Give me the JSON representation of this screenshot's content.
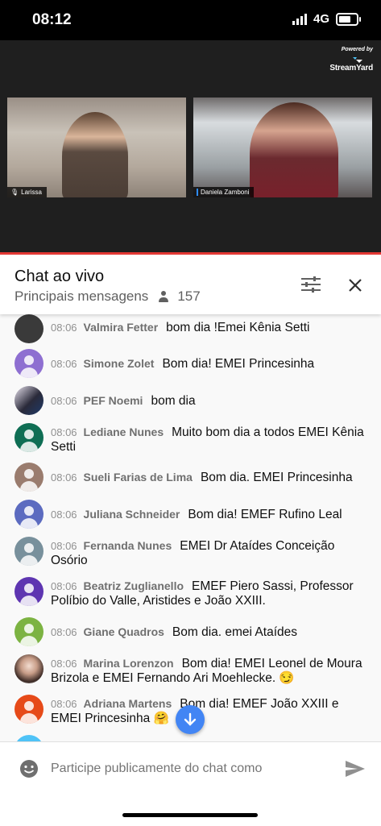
{
  "status_bar": {
    "time": "08:12",
    "network": "4G"
  },
  "stream": {
    "powered_by": "Powered by",
    "brand": "StreamYard",
    "participants": [
      {
        "name": "Larissa"
      },
      {
        "name": "Daniela Zamboni"
      }
    ]
  },
  "chat": {
    "title": "Chat ao vivo",
    "mode": "Principais mensagens",
    "viewer_count": "157",
    "messages": [
      {
        "time": "08:06",
        "author": "Valmira Fetter",
        "text": "bom dia !Emei Kênia Setti",
        "avatar_color": "#3a3a3a"
      },
      {
        "time": "08:06",
        "author": "Simone Zolet",
        "text": "Bom dia! EMEI Princesinha",
        "avatar_color": "#8e6fd1"
      },
      {
        "time": "08:06",
        "author": "PEF Noemi",
        "text": "bom dia",
        "avatar_color": "#d9d2e6"
      },
      {
        "time": "08:06",
        "author": "Lediane Nunes",
        "text": "Muito bom dia a todos EMEI Kênia Setti",
        "avatar_color": "#0f6e54"
      },
      {
        "time": "08:06",
        "author": "Sueli Farias de Lima",
        "text": "Bom dia. EMEI Princesinha",
        "avatar_color": "#9a7c6e"
      },
      {
        "time": "08:06",
        "author": "Juliana Schneider",
        "text": "Bom dia! EMEF Rufino Leal",
        "avatar_color": "#5c6bc0"
      },
      {
        "time": "08:06",
        "author": "Fernanda Nunes",
        "text": "EMEI Dr Ataídes Conceição Osório",
        "avatar_color": "#78909c"
      },
      {
        "time": "08:06",
        "author": "Beatriz Zuglianello",
        "text": "EMEF Piero Sassi, Professor Políbio do Valle, Aristides e João XXIII.",
        "avatar_color": "#5e35b1"
      },
      {
        "time": "08:06",
        "author": "Giane Quadros",
        "text": "Bom dia. emei Ataídes",
        "avatar_color": "#7cb342"
      },
      {
        "time": "08:06",
        "author": "Marina Lorenzon",
        "text": "Bom dia! EMEI Leonel de Moura Brizola e EMEI Fernando Ari Moehlecke. 😏",
        "avatar_color": "#e8d5cc"
      },
      {
        "time": "08:06",
        "author": "Adriana Martens",
        "text": "Bom dia! EMEF João XXIII e EMEI Princesinha 🤗",
        "avatar_color": "#e64a19"
      }
    ],
    "input_placeholder": "Participe publicamente do chat como"
  },
  "icons": {
    "filter": "tune-icon",
    "close": "close-icon",
    "viewers": "person-icon",
    "scroll": "arrow-down-icon",
    "emoji": "emoji-icon",
    "send": "send-icon"
  }
}
